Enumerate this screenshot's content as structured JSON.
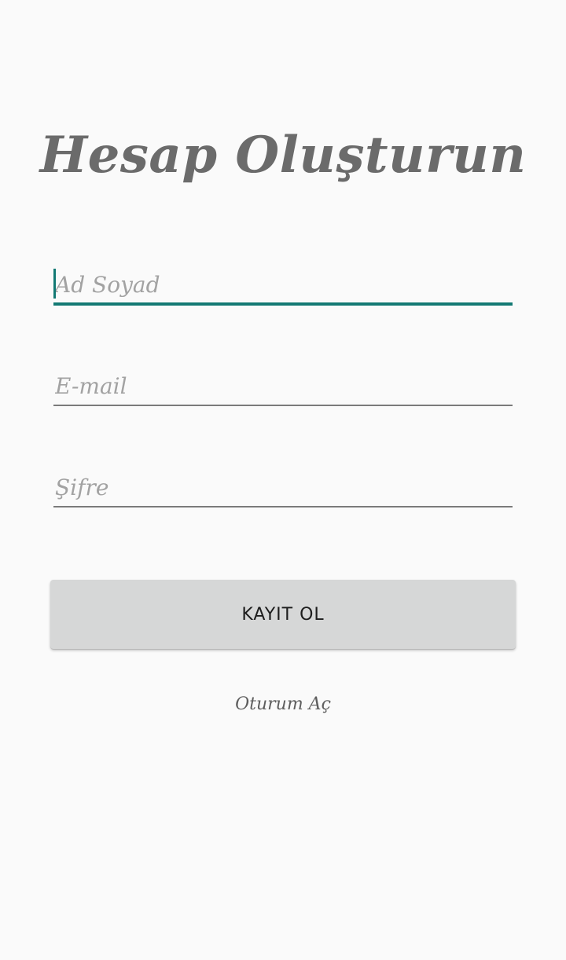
{
  "screen": {
    "title": "Hesap Oluşturun"
  },
  "form": {
    "name_field": {
      "value": "",
      "placeholder": "Ad Soyad"
    },
    "email_field": {
      "value": "",
      "placeholder": "E-mail"
    },
    "password_field": {
      "value": "",
      "placeholder": "Şifre"
    },
    "register_button_label": "KAYIT OL",
    "login_link_label": "Oturum Aç"
  },
  "colors": {
    "accent": "#137a74",
    "background": "#fafafa",
    "button": "#d6d7d7",
    "title_text": "#6b6b6b"
  }
}
